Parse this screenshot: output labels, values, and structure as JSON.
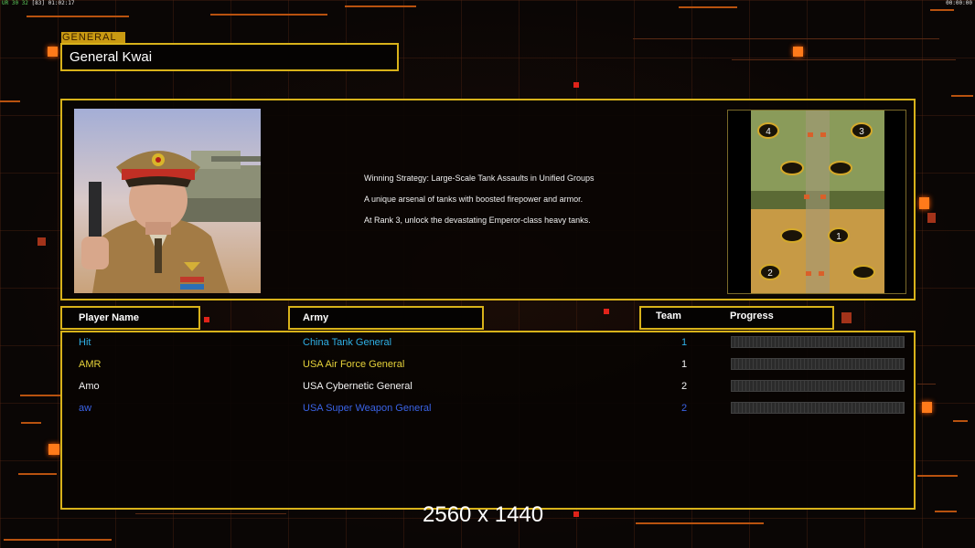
{
  "topbar": {
    "left_prefix": "UR",
    "left_stats": "30 32",
    "left_bracket": "[83]",
    "left_time": "01:02:17",
    "right_time": "00:00:00"
  },
  "general": {
    "tag": "GENERAL",
    "name": "General Kwai",
    "description": [
      "Winning Strategy: Large-Scale Tank Assaults in Unified Groups",
      "A unique arsenal of tanks with boosted firepower and armor.",
      "At Rank 3, unlock the devastating Emperor-class heavy tanks."
    ]
  },
  "minimap": {
    "start_labels": [
      "4",
      "3",
      "1",
      "2"
    ]
  },
  "table": {
    "headers": {
      "player": "Player Name",
      "army": "Army",
      "team": "Team",
      "progress": "Progress"
    },
    "rows": [
      {
        "player": "Hit",
        "army": "China Tank General",
        "team": "1",
        "color": "#2fb0e6"
      },
      {
        "player": "AMR",
        "army": "USA Air Force General",
        "team": "1",
        "color": "#e6d23a"
      },
      {
        "player": "Amo",
        "army": "USA Cybernetic General",
        "team": "2",
        "color": "#f2f2f2"
      },
      {
        "player": "aw",
        "army": "USA Super Weapon General",
        "team": "2",
        "color": "#3a63e6"
      }
    ]
  },
  "resolution_label": "2560 x 1440",
  "colors": {
    "panel_border": "#d8b21a",
    "accent_orange": "#ff7a1a",
    "background": "#0a0605"
  }
}
